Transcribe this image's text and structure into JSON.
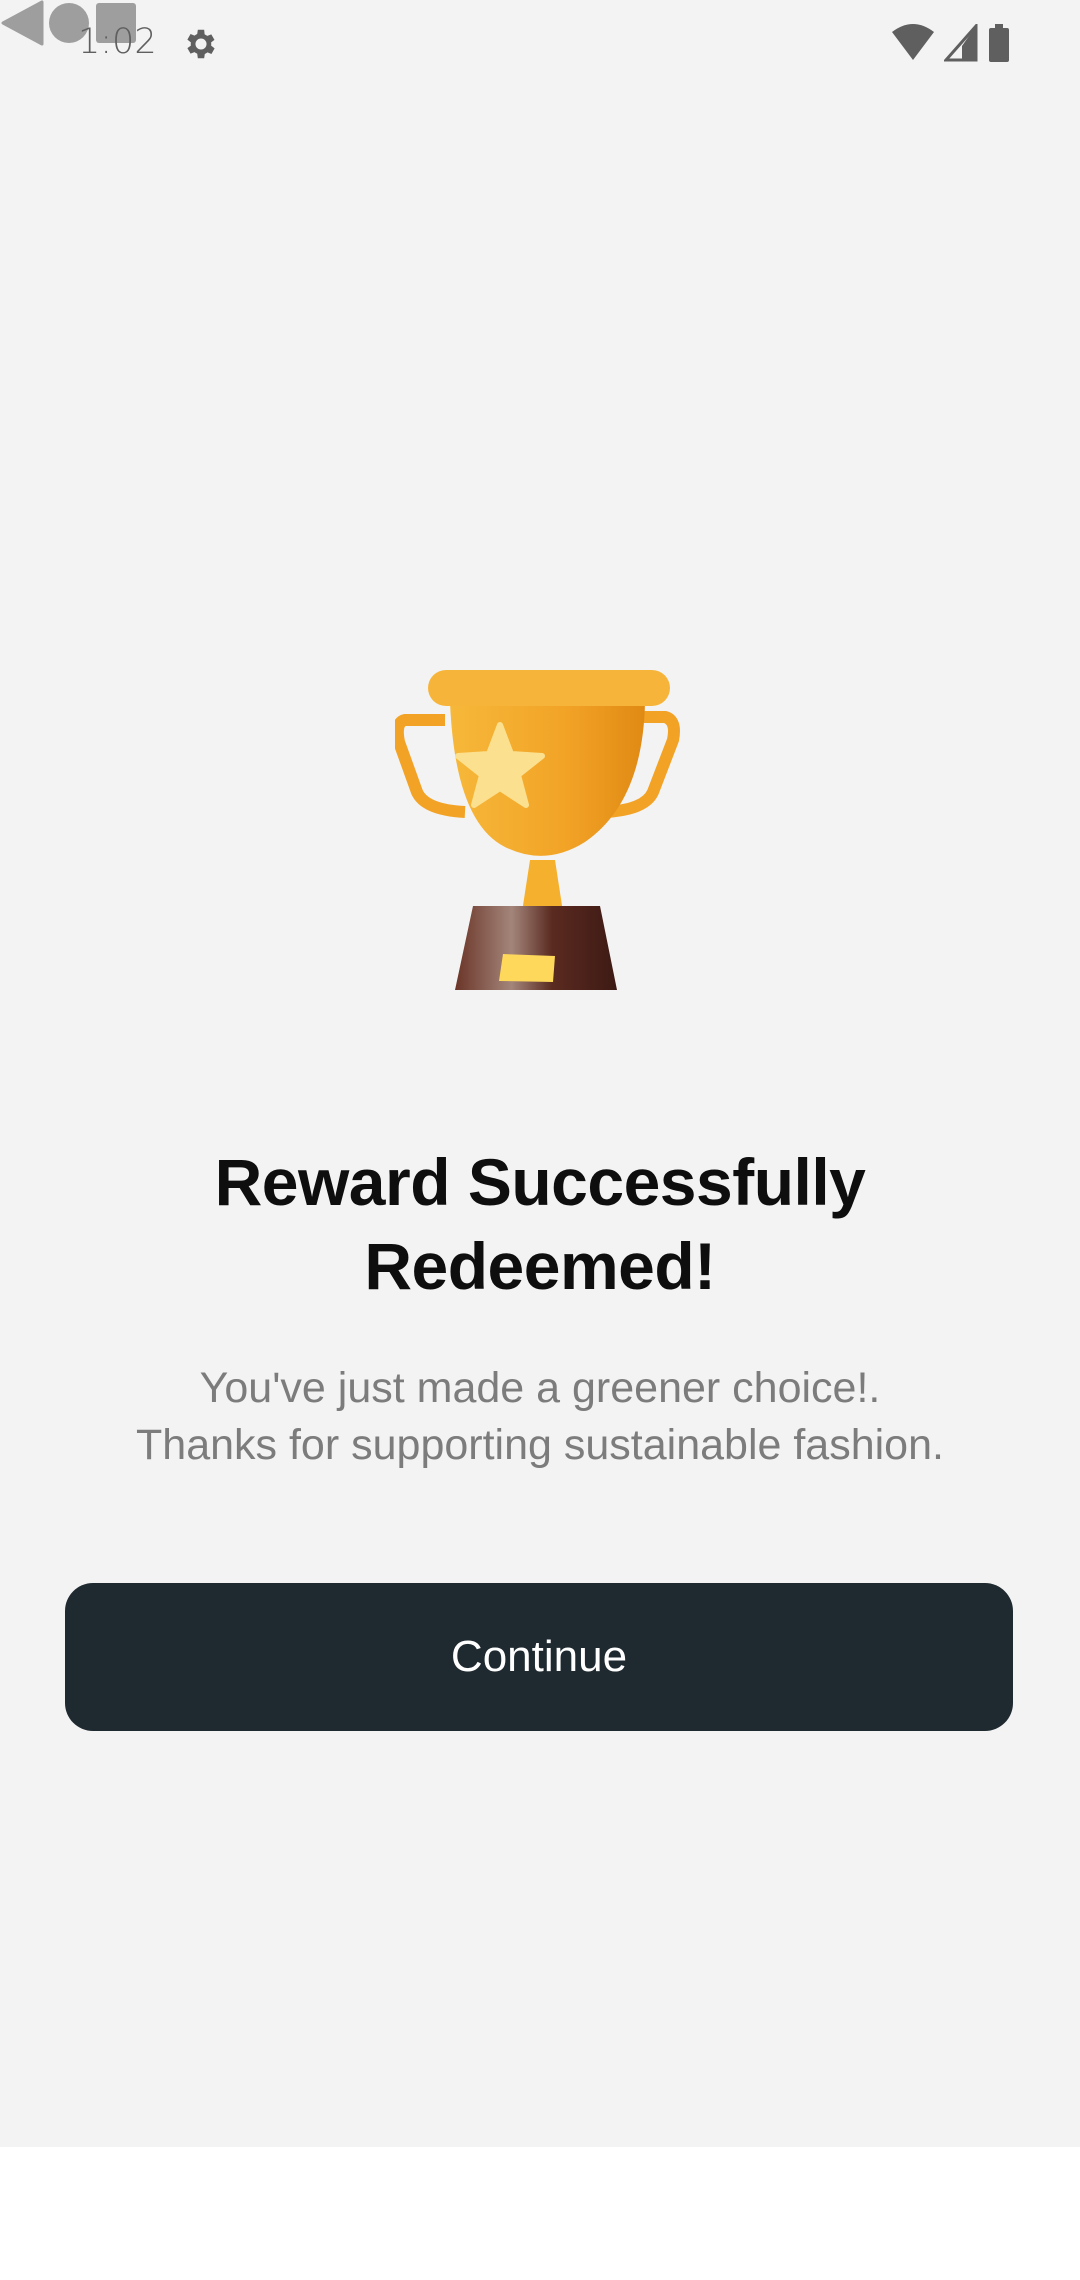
{
  "status_bar": {
    "time": "1:02",
    "icons": [
      "gear-icon",
      "wifi-icon",
      "signal-icon",
      "battery-icon"
    ]
  },
  "illustration": {
    "icon": "trophy-icon"
  },
  "title_line1": "Reward Successfully",
  "title_line2": "Redeemed!",
  "subtitle_line1": "You've just made a greener choice!.",
  "subtitle_line2": "Thanks for supporting sustainable fashion.",
  "continue_label": "Continue",
  "colors": {
    "button": "#1f2a30",
    "background": "#f3f3f3",
    "trophy_gold": "#f4a623",
    "trophy_base": "#5a2a20"
  },
  "nav_bar": {
    "icons": [
      "back-icon",
      "home-icon",
      "recents-icon"
    ]
  }
}
